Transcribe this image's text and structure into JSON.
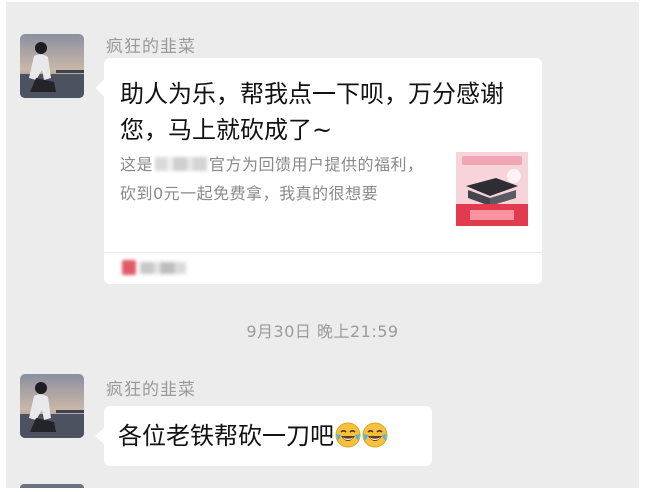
{
  "messages": [
    {
      "sender": "疯狂的韭菜",
      "avatar_icon": "person-by-river-avatar",
      "card": {
        "title": "助人为乐，帮我点一下呗，万分感谢您，马上就砍成了~",
        "desc_before": "这是",
        "desc_after": "官方为回馈用户提供的福利，砍到0元一起免费拿，我真的很想要",
        "thumbnail_icon": "product-thumbnail-icon",
        "source_icon": "app-logo-icon"
      }
    },
    {
      "sender": "疯狂的韭菜",
      "avatar_icon": "person-by-river-avatar",
      "text": "各位老铁帮砍一刀吧",
      "emojis": [
        "crying-laughing-emoji",
        "crying-laughing-emoji"
      ]
    }
  ],
  "timestamp": "9月30日 晚上21:59",
  "colors": {
    "background": "#ececec",
    "bubble": "#ffffff",
    "name": "#9a9a9a",
    "time": "#9b9b9b",
    "text": "#111111"
  }
}
